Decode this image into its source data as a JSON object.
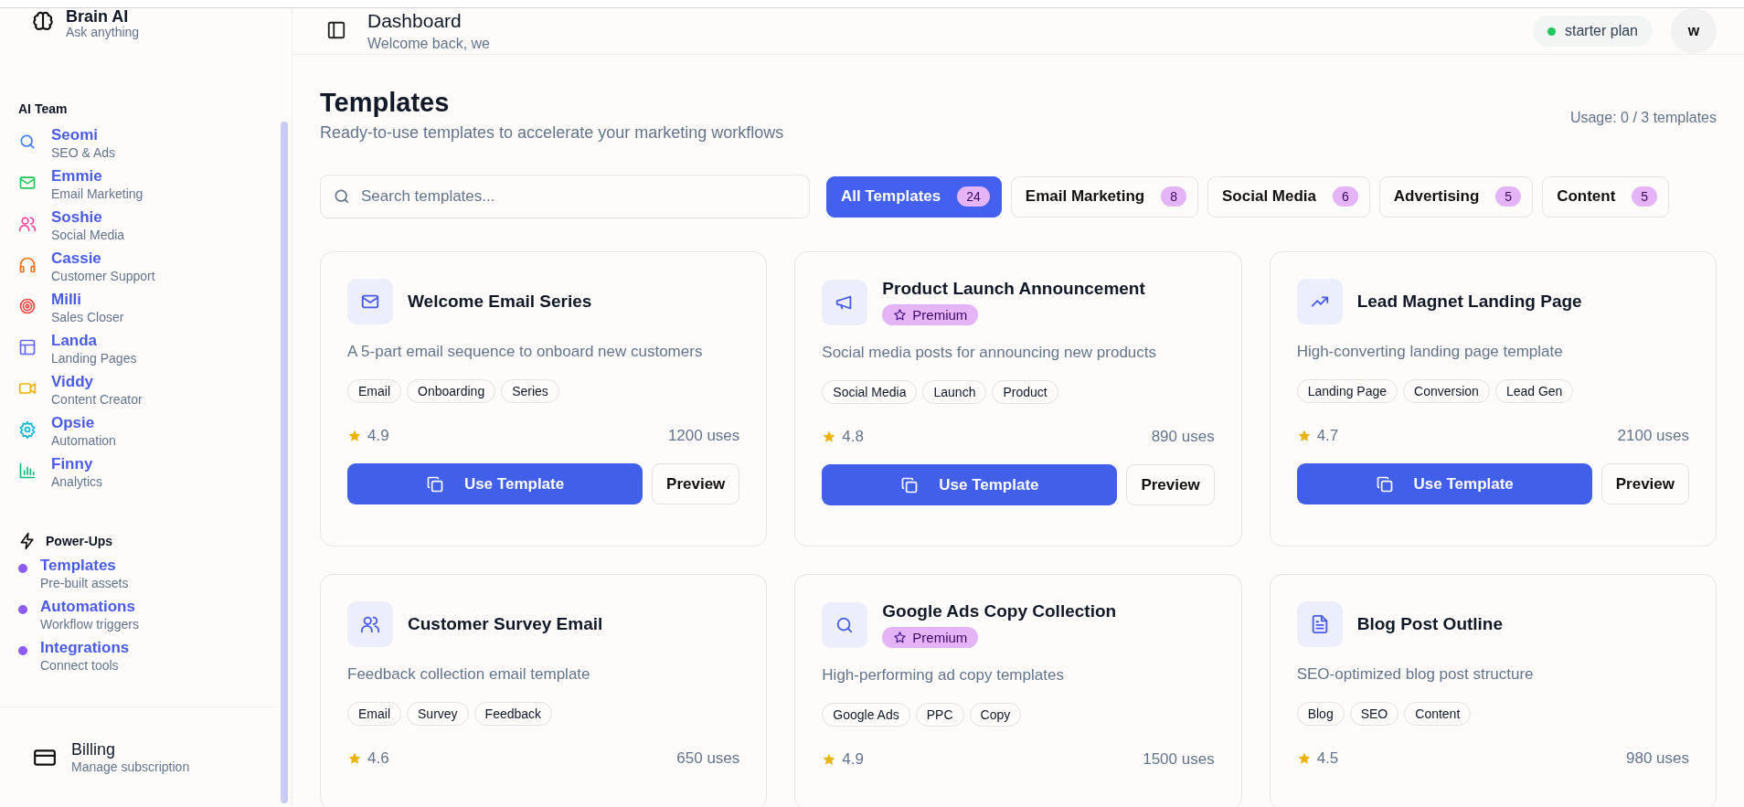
{
  "brand": {
    "name": "Brain AI",
    "tagline": "Ask anything"
  },
  "sidebar": {
    "team_heading": "AI Team",
    "agents": [
      {
        "name": "Seomi",
        "role": "SEO & Ads",
        "color": "#3b82f6"
      },
      {
        "name": "Emmie",
        "role": "Email Marketing",
        "color": "#22c55e"
      },
      {
        "name": "Soshie",
        "role": "Social Media",
        "color": "#ec4899"
      },
      {
        "name": "Cassie",
        "role": "Customer Support",
        "color": "#f97316"
      },
      {
        "name": "Milli",
        "role": "Sales Closer",
        "color": "#ef4444"
      },
      {
        "name": "Landa",
        "role": "Landing Pages",
        "color": "#6366f1"
      },
      {
        "name": "Viddy",
        "role": "Content Creator",
        "color": "#eab308"
      },
      {
        "name": "Opsie",
        "role": "Automation",
        "color": "#06b6d4"
      },
      {
        "name": "Finny",
        "role": "Analytics",
        "color": "#10b981"
      }
    ],
    "powerups_heading": "Power-Ups",
    "powerups": [
      {
        "name": "Templates",
        "description": "Pre-built assets"
      },
      {
        "name": "Automations",
        "description": "Workflow triggers"
      },
      {
        "name": "Integrations",
        "description": "Connect tools"
      }
    ],
    "billing": {
      "title": "Billing",
      "subtitle": "Manage subscription"
    }
  },
  "header": {
    "title": "Dashboard",
    "subtitle": "Welcome back, we",
    "plan": "starter plan",
    "avatar": "w"
  },
  "page": {
    "title": "Templates",
    "subtitle": "Ready-to-use templates to accelerate your marketing workflows",
    "usage": "Usage: 0 / 3 templates"
  },
  "search": {
    "placeholder": "Search templates..."
  },
  "filters": [
    {
      "label": "All Templates",
      "count": "24",
      "selected": true
    },
    {
      "label": "Email Marketing",
      "count": "8",
      "selected": false
    },
    {
      "label": "Social Media",
      "count": "6",
      "selected": false
    },
    {
      "label": "Advertising",
      "count": "5",
      "selected": false
    },
    {
      "label": "Content",
      "count": "5",
      "selected": false
    }
  ],
  "cards": [
    {
      "title": "Welcome Email Series",
      "description": "A 5-part email sequence to onboard new customers",
      "tags": [
        "Email",
        "Onboarding",
        "Series"
      ],
      "rating": "4.9",
      "uses": "1200 uses",
      "actions": [
        "Use Template",
        "Preview"
      ]
    },
    {
      "title": "Product Launch Announcement",
      "badge": "Premium",
      "description": "Social media posts for announcing new products",
      "tags": [
        "Social Media",
        "Launch",
        "Product"
      ],
      "rating": "4.8",
      "uses": "890 uses",
      "actions": [
        "Use Template",
        "Preview"
      ]
    },
    {
      "title": "Lead Magnet Landing Page",
      "description": "High-converting landing page template",
      "tags": [
        "Landing Page",
        "Conversion",
        "Lead Gen"
      ],
      "rating": "4.7",
      "uses": "2100 uses",
      "actions": [
        "Use Template",
        "Preview"
      ]
    },
    {
      "title": "Customer Survey Email",
      "description": "Feedback collection email template",
      "tags": [
        "Email",
        "Survey",
        "Feedback"
      ],
      "rating": "4.6",
      "uses": "650 uses"
    },
    {
      "title": "Google Ads Copy Collection",
      "badge": "Premium",
      "description": "High-performing ad copy templates",
      "tags": [
        "Google Ads",
        "PPC",
        "Copy"
      ],
      "rating": "4.9",
      "uses": "1500 uses"
    },
    {
      "title": "Blog Post Outline",
      "description": "SEO-optimized blog post structure",
      "tags": [
        "Blog",
        "SEO",
        "Content"
      ],
      "rating": "4.5",
      "uses": "980 uses"
    }
  ]
}
